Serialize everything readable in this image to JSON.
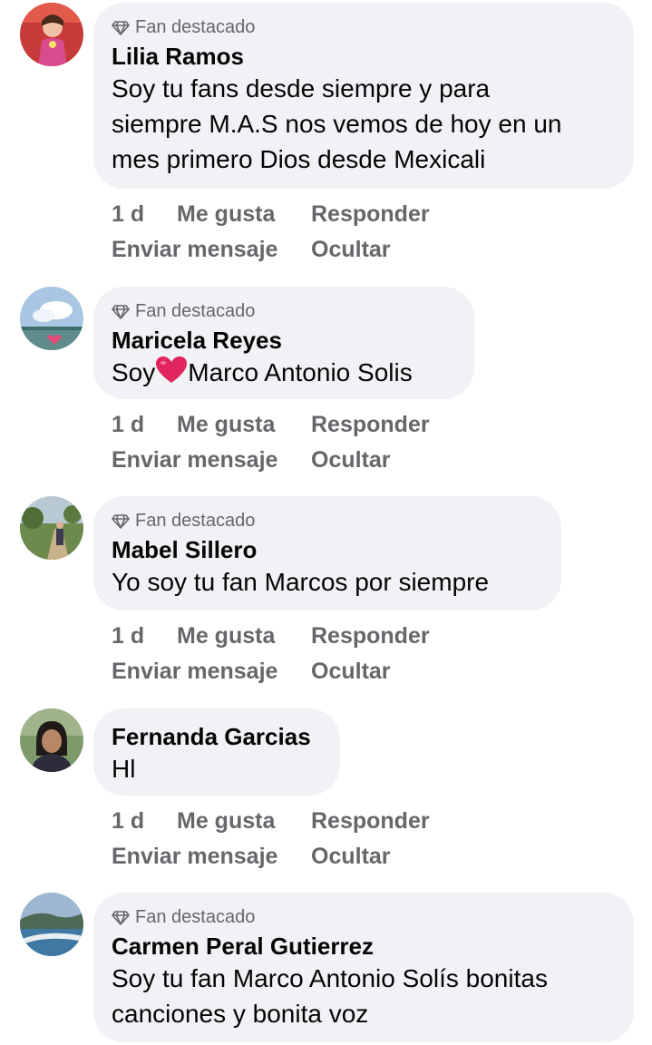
{
  "comments": [
    {
      "badge": "Fan destacado",
      "author": "Lilia Ramos",
      "text_lines": [
        "Soy tu fans desde siempre  y para",
        "siempre M.A.S  nos vemos de hoy en un",
        "mes primero Dios desde Mexicali"
      ],
      "time": "1 d",
      "like": "Me gusta",
      "reply": "Responder",
      "message": "Enviar mensaje",
      "hide": "Ocultar"
    },
    {
      "badge": "Fan destacado",
      "author": "Maricela Reyes",
      "text_before": "Soy",
      "text_after": "Marco Antonio Solis",
      "time": "1 d",
      "like": "Me gusta",
      "reply": "Responder",
      "message": "Enviar mensaje",
      "hide": "Ocultar"
    },
    {
      "badge": "Fan destacado",
      "author": "Mabel Sillero",
      "text": "Yo soy tu fan Marcos por siempre",
      "time": "1 d",
      "like": "Me gusta",
      "reply": "Responder",
      "message": "Enviar mensaje",
      "hide": "Ocultar"
    },
    {
      "author": "Fernanda Garcias",
      "text": "Hl",
      "time": "1 d",
      "like": "Me gusta",
      "reply": "Responder",
      "message": "Enviar mensaje",
      "hide": "Ocultar"
    },
    {
      "badge": "Fan destacado",
      "author": "Carmen Peral Gutierrez",
      "text_lines": [
        "Soy tu fan Marco Antonio Solís bonitas",
        "canciones y bonita voz"
      ]
    }
  ],
  "icons": {
    "badge": "diamond-icon",
    "heart": "red-heart-emoji"
  },
  "colors": {
    "bubble": "#f0f2f5",
    "meta_text": "#65676b",
    "heart": "#e0245e"
  }
}
